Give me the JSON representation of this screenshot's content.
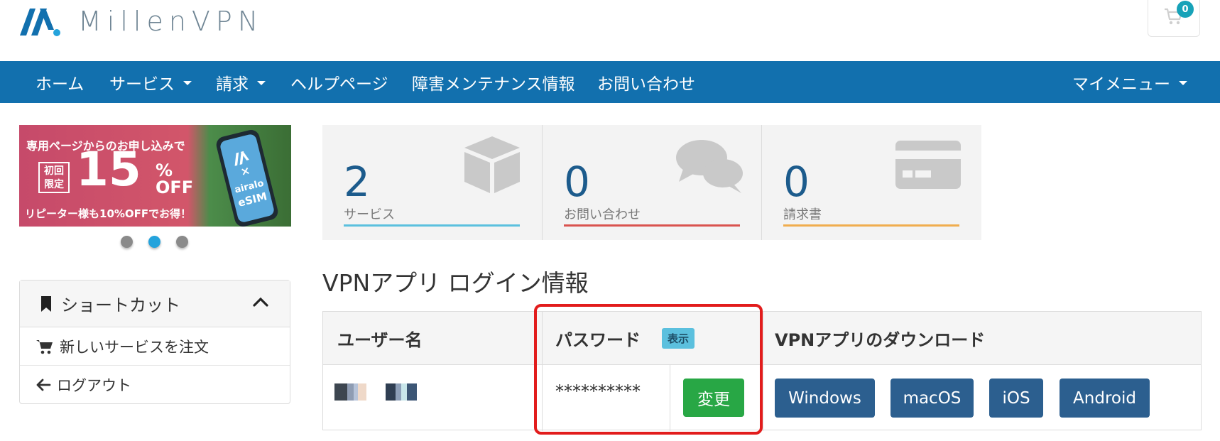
{
  "brand": {
    "name": "MillenVPN",
    "logo_color": "#1270ae",
    "accent_dot": "#24a3dc"
  },
  "cart": {
    "count": "0",
    "icon": "cart-icon"
  },
  "nav": {
    "items": [
      {
        "label": "ホーム",
        "dropdown": false
      },
      {
        "label": "サービス",
        "dropdown": true
      },
      {
        "label": "請求",
        "dropdown": true
      },
      {
        "label": "ヘルプページ",
        "dropdown": false
      },
      {
        "label": "障害メンテナンス情報",
        "dropdown": false
      },
      {
        "label": "お問い合わせ",
        "dropdown": false
      }
    ],
    "right": {
      "label": "マイメニュー",
      "dropdown": true
    },
    "color": "#1270ae"
  },
  "banner": {
    "line1": "専用ページからのお申し込みで",
    "first_time": "初回限定",
    "first_time_line1": "初回",
    "first_time_line2": "限定",
    "percent": "15",
    "percent_symbol": "%",
    "off": "OFF",
    "line2": "リピーター様も10%OFFでお得！",
    "brand_logo": "airalo",
    "esim": "eSIM",
    "times": "×",
    "dots": 3,
    "active_dot": 2
  },
  "shortcuts": {
    "title": "ショートカット",
    "items": [
      {
        "label": "新しいサービスを注文",
        "icon": "cart-icon"
      },
      {
        "label": "ログアウト",
        "icon": "arrow-left-icon"
      }
    ]
  },
  "stats": [
    {
      "value": "2",
      "label": "サービス",
      "icon": "cube-icon",
      "color": "#5bc0de"
    },
    {
      "value": "0",
      "label": "お問い合わせ",
      "icon": "chat-bubbles-icon",
      "color": "#d9534f"
    },
    {
      "value": "0",
      "label": "請求書",
      "icon": "credit-card-icon",
      "color": "#f0ad4e"
    }
  ],
  "vpn_login": {
    "title": "VPNアプリ ログイン情報",
    "headers": {
      "username": "ユーザー名",
      "password": "パスワード",
      "show_badge": "表示",
      "download": "VPNアプリのダウンロード"
    },
    "password_value": "**********",
    "change_button": "変更",
    "downloads": [
      "Windows",
      "macOS",
      "iOS",
      "Android"
    ],
    "download_color": "#2c5f8f",
    "change_color": "#28a745",
    "highlight_color": "#e21c1c"
  }
}
